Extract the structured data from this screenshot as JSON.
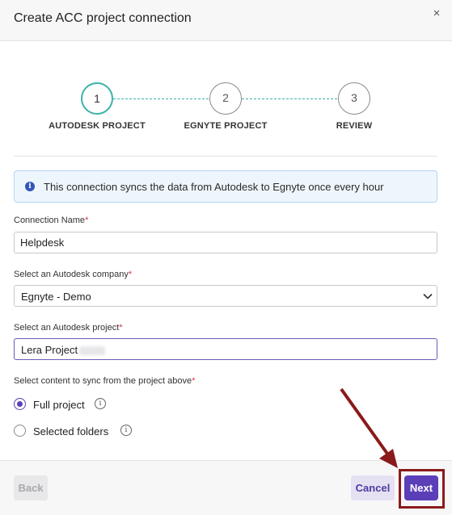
{
  "dialog": {
    "title": "Create ACC project connection",
    "close_glyph": "×"
  },
  "stepper": {
    "steps": [
      {
        "number": "1",
        "label": "AUTODESK PROJECT",
        "state": "active"
      },
      {
        "number": "2",
        "label": "EGNYTE PROJECT",
        "state": "inactive"
      },
      {
        "number": "3",
        "label": "REVIEW",
        "state": "inactive"
      }
    ],
    "active_color": "#3bb3a6"
  },
  "info": {
    "icon": "info-icon",
    "text": "This connection syncs the data from Autodesk to Egnyte once every hour"
  },
  "form": {
    "connection_name": {
      "label": "Connection Name",
      "required_mark": "*",
      "value": "Helpdesk"
    },
    "company": {
      "label": "Select an Autodesk company",
      "required_mark": "*",
      "value": "Egnyte - Demo"
    },
    "project": {
      "label": "Select an Autodesk project",
      "required_mark": "*",
      "value": "Lera Project"
    },
    "sync_content": {
      "label": "Select content to sync from the project above",
      "required_mark": "*",
      "options": [
        {
          "label": "Full project",
          "selected": true
        },
        {
          "label": "Selected folders",
          "selected": false
        }
      ]
    }
  },
  "footer": {
    "back_label": "Back",
    "cancel_label": "Cancel",
    "next_label": "Next"
  },
  "colors": {
    "primary": "#5b3fb8",
    "annotation": "#8b1a1a"
  }
}
